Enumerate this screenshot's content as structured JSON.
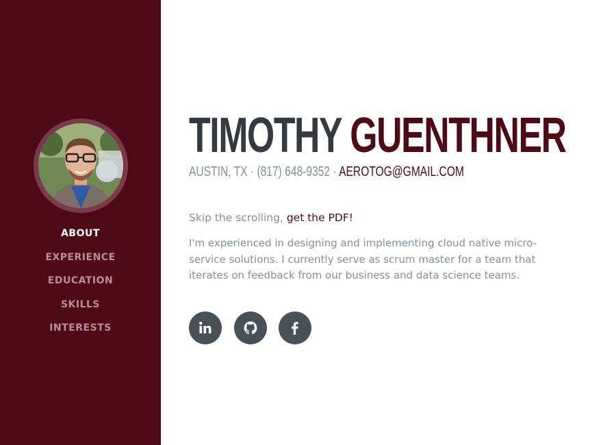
{
  "sidebar": {
    "avatar_alt": "Timothy Guenthner",
    "nav": [
      {
        "label": "ABOUT",
        "active": true
      },
      {
        "label": "EXPERIENCE",
        "active": false
      },
      {
        "label": "EDUCATION",
        "active": false
      },
      {
        "label": "SKILLS",
        "active": false
      },
      {
        "label": "INTERESTS",
        "active": false
      }
    ]
  },
  "header": {
    "first_name": "TIMOTHY",
    "last_name": "GUENTHNER",
    "location": "AUSTIN, TX",
    "separator": "·",
    "phone": "(817) 648-9352",
    "email": "AEROTOG@GMAIL.COM"
  },
  "about": {
    "skip_text": "Skip the scrolling,",
    "pdf_link": "get the PDF!",
    "bio": "I'm experienced in designing and implementing cloud native micro-service solutions. I currently serve as scrum master for a team that iterates on feedback from our business and data science teams."
  },
  "social": [
    {
      "icon": "linkedin-icon"
    },
    {
      "icon": "github-icon"
    },
    {
      "icon": "facebook-icon"
    }
  ],
  "colors": {
    "primary": "#4f0a18",
    "heading": "#343a40",
    "muted": "#868e96",
    "social_bg": "#495057"
  }
}
